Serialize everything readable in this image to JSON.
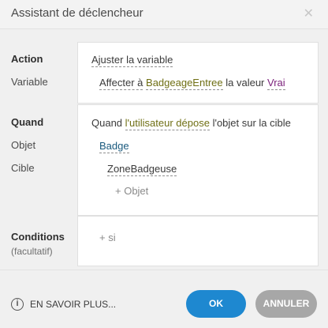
{
  "dialog": {
    "title": "Assistant de déclencheur",
    "close_glyph": "✕"
  },
  "action": {
    "label": "Action",
    "value": "Ajuster la variable",
    "variable_label": "Variable",
    "variable_prefix": "Affecter à",
    "variable_name": "BadgeageEntree",
    "variable_middle": "la valeur",
    "variable_value": "Vrai"
  },
  "when": {
    "label": "Quand",
    "object_label": "Objet",
    "target_label": "Cible",
    "sentence_prefix": "Quand",
    "sentence_trigger": "l'utilisateur dépose",
    "sentence_suffix": "l'objet sur la cible",
    "object_value": "Badge",
    "target_value": "ZoneBadgeuse",
    "add_object": "+ Objet"
  },
  "conditions": {
    "label": "Conditions",
    "sublabel": "(facultatif)",
    "add_if": "+ si"
  },
  "footer": {
    "info_glyph": "i",
    "learn_more": "EN SAVOIR PLUS...",
    "ok_label": "OK",
    "cancel_label": "ANNULER"
  },
  "colors": {
    "ok_button": "#1e88d0",
    "cancel_button": "#a7a7a7",
    "link": "#1a5a7e",
    "variable_name": "#6f6f14",
    "variable_value": "#7a1f7a"
  }
}
